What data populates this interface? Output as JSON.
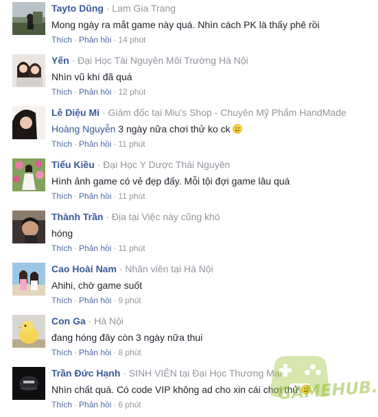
{
  "comments": [
    {
      "author": "Tayto Dũng",
      "meta": "Lam Gia Trang",
      "text": "Mong ngày ra mắt game này quá. Nhìn cách PK là thấy phê rồi",
      "like_label": "Thích",
      "reply_label": "Phản hồi",
      "time": "14 phút"
    },
    {
      "author": "Yến",
      "meta": "Đại Học Tài Nguyên Môi Trường Hà Nội",
      "text": "Nhìn vũ khí đã quá",
      "like_label": "Thích",
      "reply_label": "Phản hồi",
      "time": "12 phút"
    },
    {
      "author": "Lê Diệu Mi",
      "meta": "Giám đốc tại Miu's Shop - Chuyên Mỹ Phẩm HandMade",
      "mention": "Hoàng Nguyễn",
      "text": "3 ngày nữa chơi thử ko ck",
      "emoji": "smile-emoji",
      "like_label": "Thích",
      "reply_label": "Phản hồi",
      "time": "11 phút"
    },
    {
      "author": "Tiểu Kiều",
      "meta": "Đại Học Y Dược Thái Nguyên",
      "text": "Hình ảnh game có vẻ đẹp đấy. Mỗi tội đợi game lâu quá",
      "like_label": "Thích",
      "reply_label": "Phản hồi",
      "time": "11 phút"
    },
    {
      "author": "Thành Trần",
      "meta": "Địa tại Việc này cũng khó",
      "text": "hóng",
      "like_label": "Thích",
      "reply_label": "Phản hồi",
      "time": "11 phút"
    },
    {
      "author": "Cao Hoài Nam",
      "meta": "Nhân viên tại Hà Nội",
      "text": "Ahihi, chờ game suốt",
      "like_label": "Thích",
      "reply_label": "Phản hồi",
      "time": "9 phút"
    },
    {
      "author": "Con Ga",
      "meta": "Hà Nội",
      "text": "đang hóng đây còn 3 ngày nữa thui",
      "like_label": "Thích",
      "reply_label": "Phản hồi",
      "time": "8 phút"
    },
    {
      "author": "Trần Đức Hạnh",
      "meta": "SINH VIÊN tại Đại Học Thương Mại",
      "text": "Nhìn chất quá. Có code VIP không ad cho xin cái chơi thử",
      "emoji": "smile-emoji",
      "like_label": "Thích",
      "reply_label": "Phản hồi",
      "time": "6 phút"
    }
  ],
  "separator": "·",
  "watermark": {
    "text": "GAMEHUB.VN",
    "color": "#96be3c"
  },
  "colors": {
    "author": "#365899",
    "meta": "#90949c",
    "text": "#1d2129",
    "action": "#4b67a1"
  }
}
